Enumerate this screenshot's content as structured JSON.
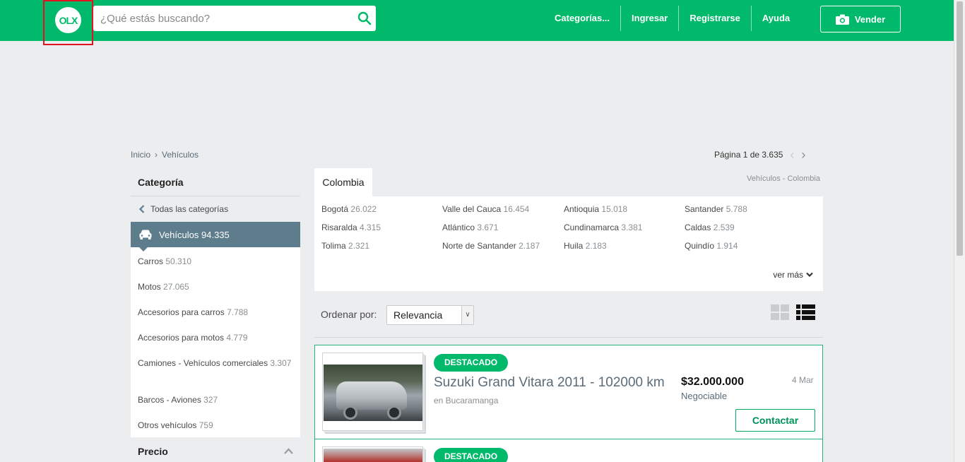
{
  "header": {
    "logo_text": "OLX",
    "search_placeholder": "¿Qué estás buscando?",
    "nav": [
      "Categorías...",
      "Ingresar",
      "Registrarse",
      "Ayuda"
    ],
    "sell_label": "Vender",
    "brand_color": "#00b96b"
  },
  "breadcrumb": [
    "Inicio",
    "Vehículos"
  ],
  "pagination": {
    "label": "Página 1 de 3.635"
  },
  "sidebar": {
    "header": "Categoría",
    "all_label": "Todas las categorías",
    "active": {
      "label": "Vehículos",
      "count": "94.335"
    },
    "items": [
      {
        "label": "Carros",
        "count": "50.310"
      },
      {
        "label": "Motos",
        "count": "27.065"
      },
      {
        "label": "Accesorios para carros",
        "count": "7.788"
      },
      {
        "label": "Accesorios para motos",
        "count": "4.779"
      },
      {
        "label": "Camiones - Vehículos comerciales",
        "count": "3.307"
      },
      {
        "label": "Barcos - Aviones",
        "count": "327"
      },
      {
        "label": "Otros vehículos",
        "count": "759"
      }
    ],
    "price_header": "Precio"
  },
  "locations": {
    "tab": "Colombia",
    "path": "Vehículos - Colombia",
    "items": [
      {
        "name": "Bogotá",
        "count": "26.022"
      },
      {
        "name": "Valle del Cauca",
        "count": "16.454"
      },
      {
        "name": "Antioquia",
        "count": "15.018"
      },
      {
        "name": "Santander",
        "count": "5.788"
      },
      {
        "name": "Risaralda",
        "count": "4.315"
      },
      {
        "name": "Atlántico",
        "count": "3.671"
      },
      {
        "name": "Cundinamarca",
        "count": "3.381"
      },
      {
        "name": "Caldas",
        "count": "2.539"
      },
      {
        "name": "Tolima",
        "count": "2.321"
      },
      {
        "name": "Norte de Santander",
        "count": "2.187"
      },
      {
        "name": "Huila",
        "count": "2.183"
      },
      {
        "name": "Quindío",
        "count": "1.914"
      }
    ],
    "more_label": "ver más"
  },
  "sort": {
    "label": "Ordenar por:",
    "selected": "Relevancia"
  },
  "listings": [
    {
      "badge": "DESTACADO",
      "title": "Suzuki Grand Vitara 2011 - 102000 km",
      "location": "en Bucaramanga",
      "price": "$32.000.000",
      "negotiable": "Negociable",
      "date": "4 Mar",
      "contact": "Contactar"
    },
    {
      "badge": "DESTACADO"
    }
  ]
}
